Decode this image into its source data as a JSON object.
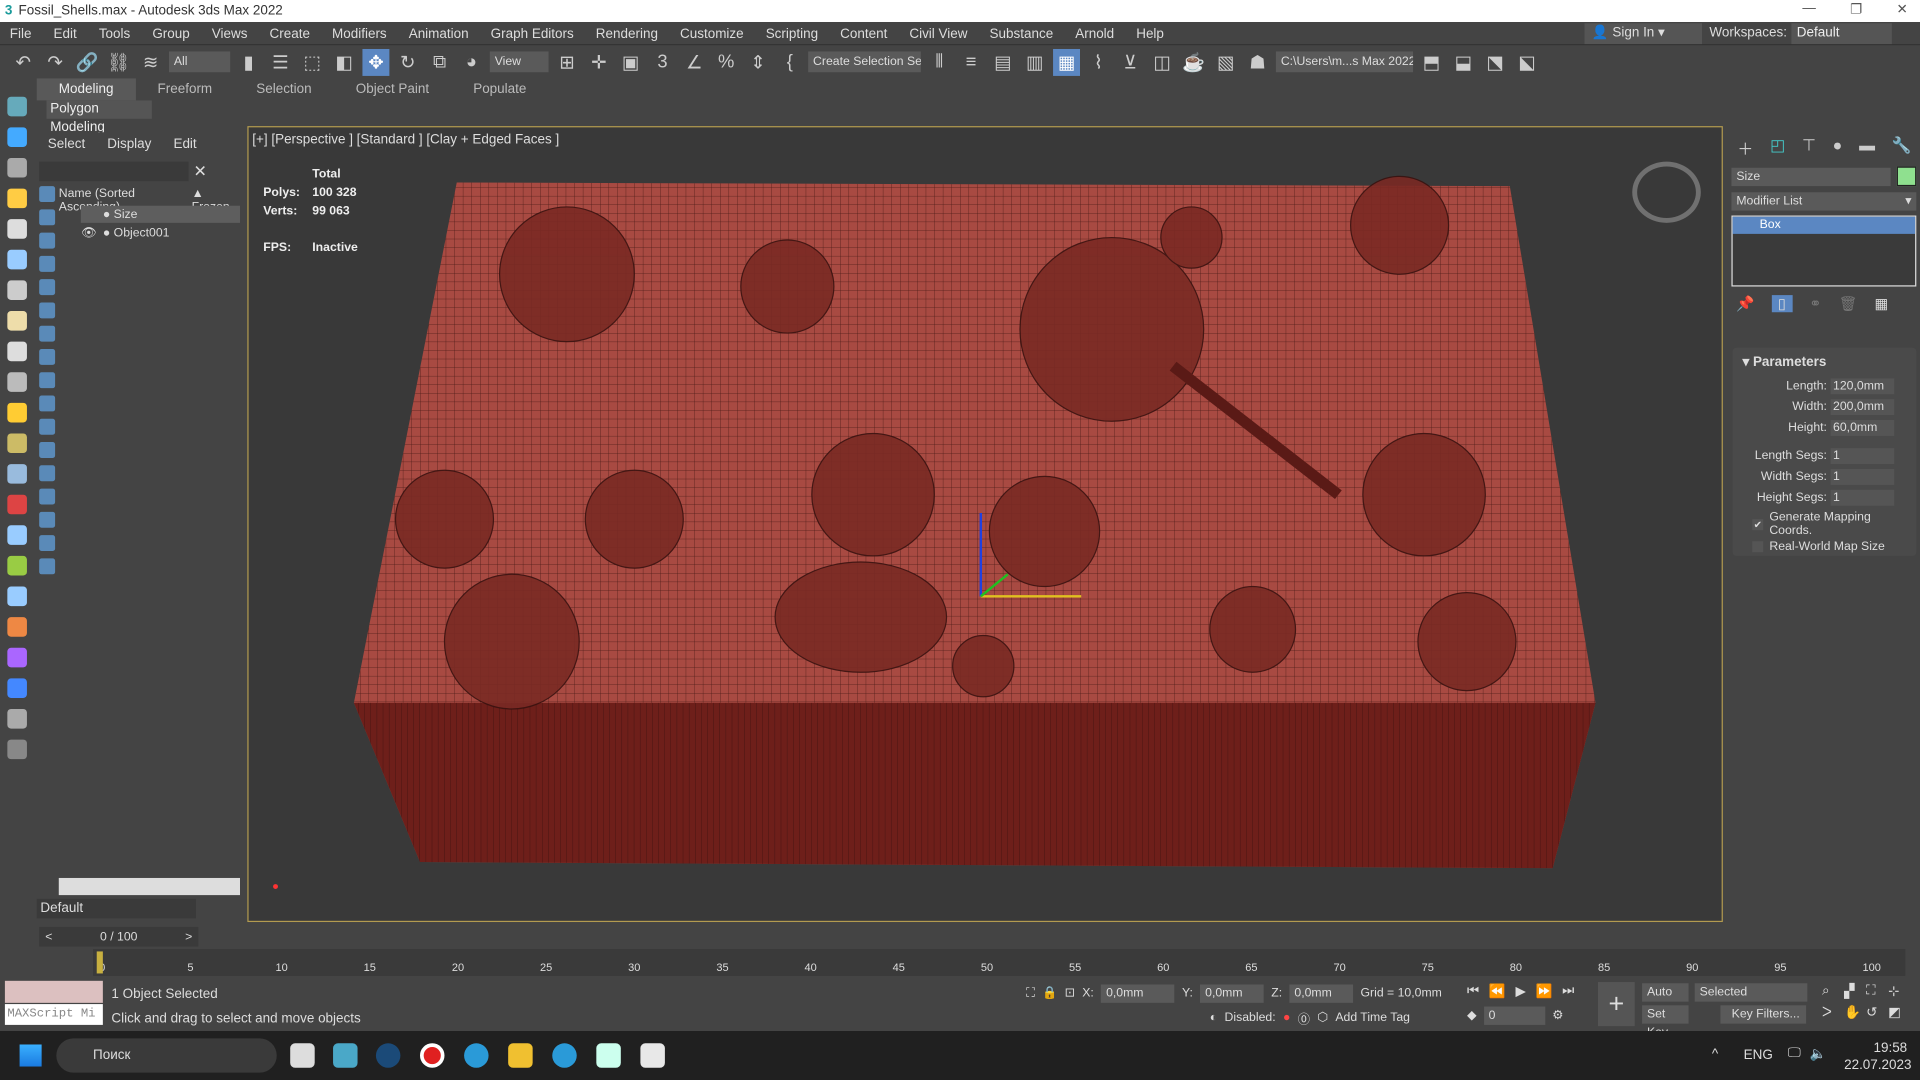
{
  "window": {
    "title": "Fossil_Shells.max - Autodesk 3ds Max 2022",
    "app_icon": "3"
  },
  "menu": [
    "File",
    "Edit",
    "Tools",
    "Group",
    "Views",
    "Create",
    "Modifiers",
    "Animation",
    "Graph Editors",
    "Rendering",
    "Customize",
    "Scripting",
    "Content",
    "Civil View",
    "Substance",
    "Arnold",
    "Help"
  ],
  "account": {
    "sign_in": "Sign In",
    "workspaces_label": "Workspaces:",
    "workspace": "Default"
  },
  "toolbar": {
    "filter": "All",
    "ref_coord": "View",
    "selection_set": "Create Selection Se",
    "project_path": "C:\\Users\\m...s Max 2022"
  },
  "ribbon": {
    "tabs": [
      "Modeling",
      "Freeform",
      "Selection",
      "Object Paint",
      "Populate"
    ],
    "active": "Modeling",
    "panel": "Polygon Modeling"
  },
  "explorer": {
    "tabs": [
      "Select",
      "Display",
      "Edit"
    ],
    "col_name": "Name (Sorted Ascending)",
    "col_frozen": "▲ Frozen",
    "rows": [
      "Size",
      "Object001"
    ],
    "layer": "Default"
  },
  "viewport": {
    "label": "[+] [Perspective ] [Standard ] [Clay + Edged Faces ]",
    "stats": {
      "total": "Total",
      "polys_label": "Polys:",
      "polys": "100 328",
      "verts_label": "Verts:",
      "verts": "99 063",
      "fps_label": "FPS:",
      "fps": "Inactive"
    }
  },
  "command_panel": {
    "object_name": "Size",
    "object_color": "#8fe08f",
    "modifier_list": "Modifier List",
    "stack": [
      "Box"
    ],
    "rollout": "Parameters",
    "params": [
      {
        "label": "Length:",
        "value": "120,0mm"
      },
      {
        "label": "Width:",
        "value": "200,0mm"
      },
      {
        "label": "Height:",
        "value": "60,0mm"
      },
      {
        "label": "Length Segs:",
        "value": "1"
      },
      {
        "label": "Width Segs:",
        "value": "1"
      },
      {
        "label": "Height Segs:",
        "value": "1"
      }
    ],
    "gen_mapping": "Generate Mapping Coords.",
    "real_world": "Real-World Map Size"
  },
  "timeline": {
    "frame": "0 / 100",
    "prev": "<",
    "next": ">",
    "ticks": [
      "0",
      "5",
      "10",
      "15",
      "20",
      "25",
      "30",
      "35",
      "40",
      "45",
      "50",
      "55",
      "60",
      "65",
      "70",
      "75",
      "80",
      "85",
      "90",
      "95",
      "100"
    ]
  },
  "status": {
    "selected": "1 Object Selected",
    "prompt": "Click and drag to select and move objects",
    "maxscript": "MAXScript Mi",
    "x_label": "X:",
    "x": "0,0mm",
    "y_label": "Y:",
    "y": "0,0mm",
    "z_label": "Z:",
    "z": "0,0mm",
    "grid": "Grid = 10,0mm",
    "disabled": "Disabled:",
    "add_time_tag": "Add Time Tag",
    "auto_key": "Auto Key",
    "set_key": "Set Key",
    "key_mode": "Selected",
    "key_filters": "Key Filters...",
    "current_frame": "0"
  },
  "taskbar": {
    "search": "Поиск",
    "lang": "ENG",
    "time": "19:58",
    "date": "22.07.2023"
  }
}
